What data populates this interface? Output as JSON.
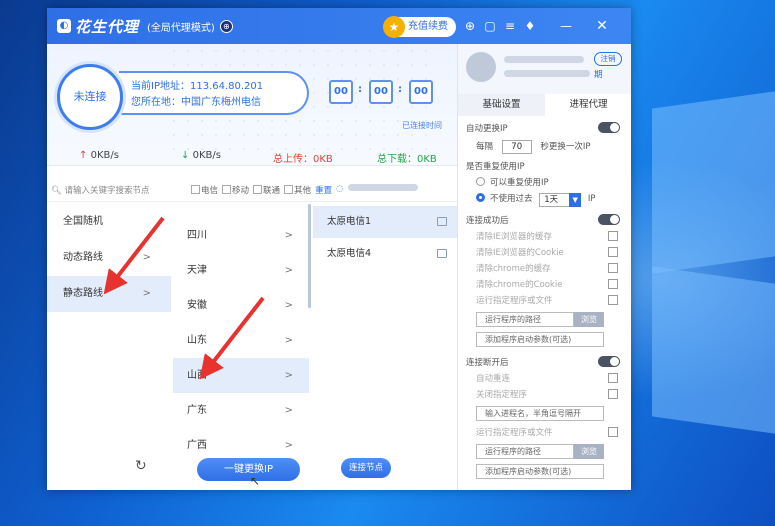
{
  "app": {
    "name": "花生代理",
    "mode": "(全局代理模式)",
    "recharge_label": "充值续费"
  },
  "status": {
    "connect_label": "未连接",
    "ip_line": "当前IP地址：113.64.80.201",
    "loc_line": "您所在地：中国广东梅州电信",
    "timer": [
      "00",
      "00",
      "00"
    ],
    "timer_label": "已连接时间",
    "up_speed": "0KB/s",
    "down_speed": "0KB/s",
    "total_up": "总上传：0KB",
    "total_down": "总下载：0KB"
  },
  "filter": {
    "search_placeholder": "请输入关键字搜索节点",
    "options": [
      "电信",
      "移动",
      "联通",
      "其他"
    ],
    "reset_label": "重置"
  },
  "routes": {
    "categories": [
      "全国随机",
      "动态路线",
      "静态路线"
    ],
    "provinces": [
      "四川",
      "天津",
      "安徽",
      "山东",
      "山西",
      "广东",
      "广西"
    ],
    "nodes": [
      "太原电信1",
      "太原电信4"
    ]
  },
  "buttons": {
    "switch_ip": "一键更换IP",
    "connect_node": "连接节点"
  },
  "user": {
    "logout_label": "注销",
    "expire_suffix": "期"
  },
  "tabs": [
    "基础设置",
    "进程代理"
  ],
  "settings": {
    "auto_ip": "自动更换IP",
    "every": "每隔",
    "seconds_value": "70",
    "per_seconds": "秒更换一次IP",
    "reuse_ip": "是否重复使用IP",
    "can_reuse": "可以重复使用IP",
    "no_reuse": "不使用过去",
    "days_value": "1天",
    "ip_suffix": "IP",
    "after_connect": "连接成功后",
    "after_connect_items": [
      "清除IE浏览器的缓存",
      "清除IE浏览器的Cookie",
      "清除chrome的缓存",
      "清除chrome的Cookie",
      "运行指定程序或文件"
    ],
    "program_path": "运行程序的路径",
    "browse": "浏览",
    "startup_args": "添加程序启动参数(可选)",
    "after_disconnect": "连接断开后",
    "after_disconnect_items": [
      "自动重连",
      "关闭指定程序"
    ],
    "process_placeholder": "输入进程名，半角逗号隔开",
    "run_program": "运行指定程序或文件",
    "program_path2": "运行程序的路径",
    "browse2": "浏览",
    "startup_args2": "添加程序启动参数(可选)"
  },
  "colors": {
    "accent": "#2f6fe6",
    "up_arrow": "#e0453a",
    "down_arrow": "#2aa44a",
    "annotation_arrow": "#e8322e"
  }
}
